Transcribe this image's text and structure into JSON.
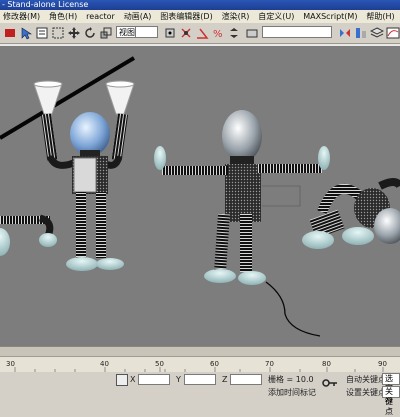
{
  "window": {
    "title": "- Stand-alone License"
  },
  "menu": {
    "items": [
      "修改器(M)",
      "角色(H)",
      "reactor",
      "动画(A)",
      "图表编辑器(D)",
      "渲染(R)",
      "自定义(U)",
      "MAXScript(M)",
      "帮助(H)"
    ]
  },
  "toolbar": {
    "view_dropdown": "视图"
  },
  "timeline": {
    "ticks": [
      "30",
      "40",
      "50",
      "60",
      "70",
      "80",
      "90"
    ]
  },
  "status": {
    "x_label": "X",
    "y_label": "Y",
    "z_label": "Z",
    "grid_text": "栅格 = 10.0",
    "add_time_tag": "添加时间标记",
    "auto_key": "自动关键点",
    "auto_key_field": "选定对",
    "set_key": "设置关键点",
    "key_filters": "关键点"
  },
  "colors": {
    "viewport_bg": "#7d7d7d",
    "title_bar": "#2a56b6",
    "ui_face": "#d4d0c8"
  }
}
